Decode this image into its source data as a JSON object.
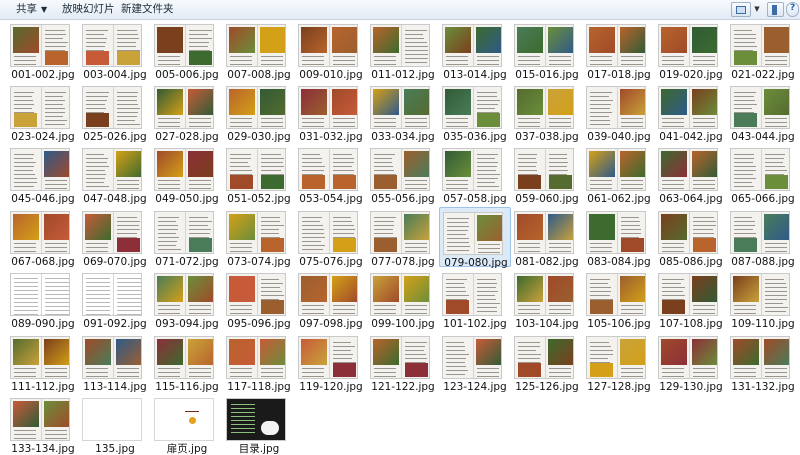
{
  "toolbar": {
    "share_label": "共享",
    "slideshow_label": "放映幻灯片",
    "new_folder_label": "新建文件夹"
  },
  "files": [
    "001-002.jpg",
    "003-004.jpg",
    "005-006.jpg",
    "007-008.jpg",
    "009-010.jpg",
    "011-012.jpg",
    "013-014.jpg",
    "015-016.jpg",
    "017-018.jpg",
    "019-020.jpg",
    "021-022.jpg",
    "023-024.jpg",
    "025-026.jpg",
    "027-028.jpg",
    "029-030.jpg",
    "031-032.jpg",
    "033-034.jpg",
    "035-036.jpg",
    "037-038.jpg",
    "039-040.jpg",
    "041-042.jpg",
    "043-044.jpg",
    "045-046.jpg",
    "047-048.jpg",
    "049-050.jpg",
    "051-052.jpg",
    "053-054.jpg",
    "055-056.jpg",
    "057-058.jpg",
    "059-060.jpg",
    "061-062.jpg",
    "063-064.jpg",
    "065-066.jpg",
    "067-068.jpg",
    "069-070.jpg",
    "071-072.jpg",
    "073-074.jpg",
    "075-076.jpg",
    "077-078.jpg",
    "079-080.jpg",
    "081-082.jpg",
    "083-084.jpg",
    "085-086.jpg",
    "087-088.jpg",
    "089-090.jpg",
    "091-092.jpg",
    "093-094.jpg",
    "095-096.jpg",
    "097-098.jpg",
    "099-100.jpg",
    "101-102.jpg",
    "103-104.jpg",
    "105-106.jpg",
    "107-108.jpg",
    "109-110.jpg",
    "111-112.jpg",
    "113-114.jpg",
    "115-116.jpg",
    "117-118.jpg",
    "119-120.jpg",
    "121-122.jpg",
    "123-124.jpg",
    "125-126.jpg",
    "127-128.jpg",
    "129-130.jpg",
    "131-132.jpg",
    "133-134.jpg",
    "135.jpg",
    "扉页.jpg",
    "目录.jpg"
  ],
  "selected_file": "079-080.jpg",
  "colors": {
    "selection_bg": "#dceaf8",
    "selection_border": "#9cc3ea",
    "toolbar_top": "#f7fafd",
    "toolbar_bottom": "#e3ebf5"
  },
  "icons": {
    "view_options": "view-icon",
    "preview_pane": "preview-pane-icon",
    "help": "help-icon"
  }
}
